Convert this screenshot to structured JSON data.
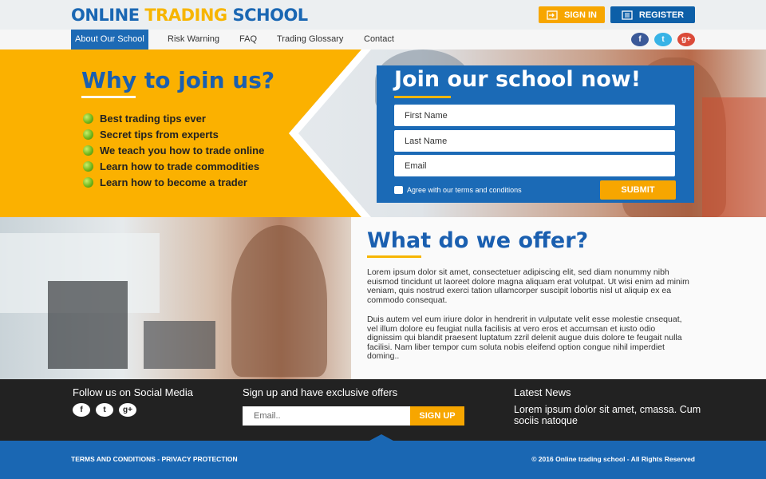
{
  "header": {
    "logo": {
      "part1": "ONLINE ",
      "part2": "TRADING",
      "part3": " SCHOOL"
    },
    "signin_label": "SIGN IN",
    "register_label": "REGISTER"
  },
  "nav": {
    "items": [
      {
        "label": "About Our School",
        "active": true
      },
      {
        "label": "Risk Warning",
        "active": false
      },
      {
        "label": "FAQ",
        "active": false
      },
      {
        "label": "Trading Glossary",
        "active": false
      },
      {
        "label": "Contact",
        "active": false
      }
    ],
    "social": [
      "f",
      "t",
      "g+"
    ]
  },
  "hero": {
    "why_title": "Why to join us?",
    "why_items": [
      "Best trading tips ever",
      "Secret tips from experts",
      "We teach you how to trade online",
      "Learn how to trade commodities",
      "Learn how to become a trader"
    ],
    "join_title": "Join our school now!",
    "first_name_placeholder": "First Name",
    "last_name_placeholder": "Last Name",
    "email_placeholder": "Email",
    "agree_label": "Agree with our terms and conditions",
    "submit_label": "SUBMIT"
  },
  "offer": {
    "title": "What do we offer?",
    "paragraph1": "Lorem ipsum dolor sit amet, consectetuer adipiscing elit, sed diam nonummy nibh euismod tincidunt ut laoreet dolore magna aliquam erat volutpat. Ut wisi enim ad minim veniam, quis nostrud exerci tation ullamcorper suscipit lobortis nisl ut aliquip ex ea commodo consequat.",
    "paragraph2": "Duis autem vel eum iriure dolor in hendrerit in vulputate velit esse molestie cnsequat, vel illum dolore eu feugiat nulla facilisis at vero eros et accumsan et iusto odio dignissim qui blandit praesent luptatum zzril delenit augue duis dolore te feugait nulla facilisi. Nam liber tempor cum soluta nobis eleifend option congue nihil imperdiet doming.."
  },
  "footer": {
    "social_heading": "Follow us on Social Media",
    "social_icons": [
      "f",
      "t",
      "g+"
    ],
    "signup_heading": "Sign up and have exclusive offers",
    "email_placeholder": "Email..",
    "signup_label": "SIGN UP",
    "news_heading": "Latest News",
    "news_text": "Lorem ipsum dolor sit amet, cmassa. Cum sociis natoque",
    "terms_label": "TERMS AND CONDITIONS",
    "separator": " - ",
    "privacy_label": "PRIVACY PROTECTION",
    "copyright": "© 2016 Online trading school -  All Rights Reserved"
  },
  "colors": {
    "brand_blue": "#1a67b3",
    "brand_yellow": "#f7b500",
    "footer_dark": "#222222"
  }
}
